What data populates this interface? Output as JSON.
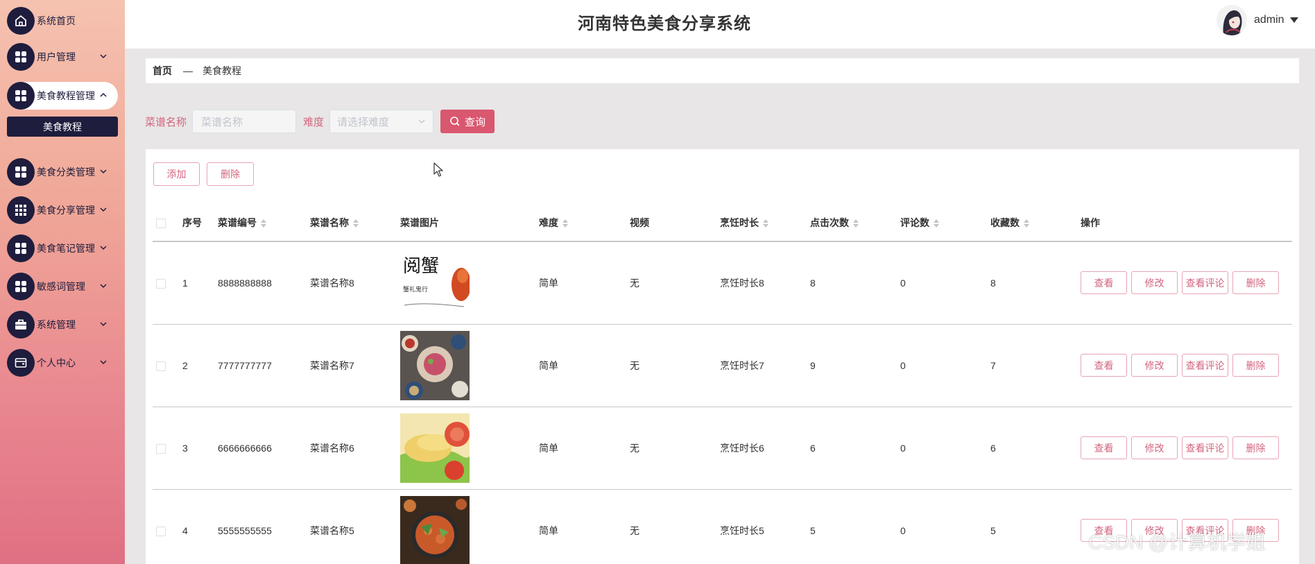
{
  "app": {
    "title": "河南特色美食分享系统",
    "username": "admin"
  },
  "sidebar": {
    "items": [
      {
        "label": "系统首页",
        "icon": "home-icon"
      },
      {
        "label": "用户管理",
        "icon": "grid-icon"
      },
      {
        "label": "美食教程管理",
        "icon": "grid-icon",
        "expanded": true
      },
      {
        "label": "美食分类管理",
        "icon": "grid-icon"
      },
      {
        "label": "美食分享管理",
        "icon": "apps-icon"
      },
      {
        "label": "美食笔记管理",
        "icon": "grid-icon"
      },
      {
        "label": "敏感词管理",
        "icon": "grid-icon"
      },
      {
        "label": "系统管理",
        "icon": "briefcase-icon"
      },
      {
        "label": "个人中心",
        "icon": "wallet-icon"
      }
    ],
    "submenu": {
      "label": "美食教程"
    }
  },
  "breadcrumb": {
    "home": "首页",
    "separator": "—",
    "current": "美食教程"
  },
  "search": {
    "name_label": "菜谱名称",
    "name_placeholder": "菜谱名称",
    "difficulty_label": "难度",
    "difficulty_placeholder": "请选择难度",
    "query_button": "查询"
  },
  "toolbar": {
    "add": "添加",
    "delete": "删除"
  },
  "table": {
    "headers": {
      "index": "序号",
      "code": "菜谱编号",
      "name": "菜谱名称",
      "image": "菜谱图片",
      "difficulty": "难度",
      "video": "视频",
      "duration": "烹饪时长",
      "clicks": "点击次数",
      "comments": "评论数",
      "favorites": "收藏数",
      "actions": "操作"
    },
    "rows": [
      {
        "index": "1",
        "code": "8888888888",
        "name": "菜谱名称8",
        "difficulty": "简单",
        "video": "无",
        "duration": "烹饪时长8",
        "clicks": "8",
        "comments": "0",
        "favorites": "8",
        "image_text": "阅蟹",
        "image_sub": "蟹礼鬼行"
      },
      {
        "index": "2",
        "code": "7777777777",
        "name": "菜谱名称7",
        "difficulty": "简单",
        "video": "无",
        "duration": "烹饪时长7",
        "clicks": "9",
        "comments": "0",
        "favorites": "7"
      },
      {
        "index": "3",
        "code": "6666666666",
        "name": "菜谱名称6",
        "difficulty": "简单",
        "video": "无",
        "duration": "烹饪时长6",
        "clicks": "6",
        "comments": "0",
        "favorites": "6"
      },
      {
        "index": "4",
        "code": "5555555555",
        "name": "菜谱名称5",
        "difficulty": "简单",
        "video": "无",
        "duration": "烹饪时长5",
        "clicks": "5",
        "comments": "0",
        "favorites": "5"
      }
    ],
    "row_actions": {
      "view": "查看",
      "edit": "修改",
      "comments": "查看评论",
      "delete": "删除"
    }
  },
  "watermark": "CSDN @计算机学姐",
  "colors": {
    "accent": "#d9576f",
    "sidebar_dark": "#1e1d3d",
    "sidebar_top": "#f6c2b0",
    "sidebar_bottom": "#e07083"
  }
}
